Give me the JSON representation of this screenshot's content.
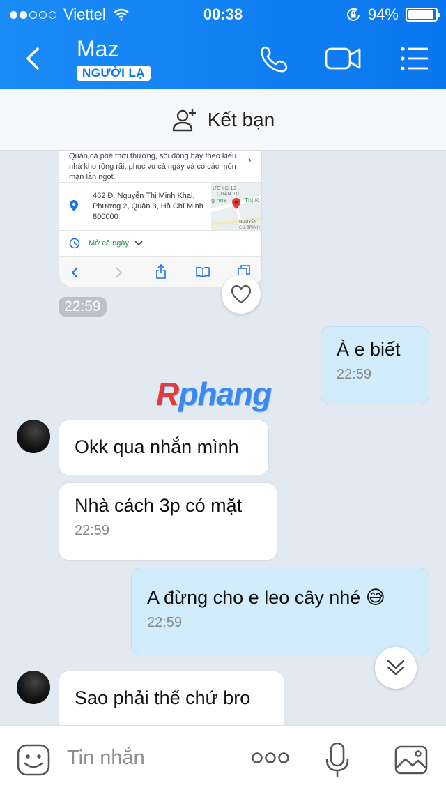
{
  "status_bar": {
    "carrier": "Viettel",
    "time": "00:38",
    "battery": "94%",
    "battery_level": 0.94
  },
  "header": {
    "contact_name": "Maz",
    "badge": "NGƯỜI LẠ"
  },
  "add_friend": {
    "label": "Kết bạn"
  },
  "shared_card": {
    "description": "Quán cà phê thời thượng, sôi động hay theo kiểu nhà kho rộng rãi, phục vụ cả ngày và có các món mặn lẫn ngọt.",
    "address": "462 Đ. Nguyễn Thị Minh Khai, Phường 2, Quận 3, Hồ Chí Minh 800000",
    "hours": "Mở cả ngày",
    "map_labels": [
      "ƯỜNG 12",
      "QUẬN 10",
      "g hoa",
      "Thị K",
      "NGUYỄN",
      "CƯ TRINH"
    ],
    "time": "22:59"
  },
  "watermark": {
    "r": "R",
    "rest": "phang"
  },
  "messages": [
    {
      "from": "me",
      "text": "À e biết",
      "time": "22:59"
    },
    {
      "from": "them",
      "text": "Okk qua nhắn mình",
      "time": ""
    },
    {
      "from": "them",
      "text": "Nhà cách 3p có mặt",
      "time": "22:59"
    },
    {
      "from": "me",
      "text": "A đừng cho e leo cây nhé 😅",
      "time": "22:59"
    },
    {
      "from": "them",
      "text": "Sao phải thế chứ bro",
      "time": ""
    }
  ],
  "composer": {
    "placeholder": "Tin nhắn"
  }
}
